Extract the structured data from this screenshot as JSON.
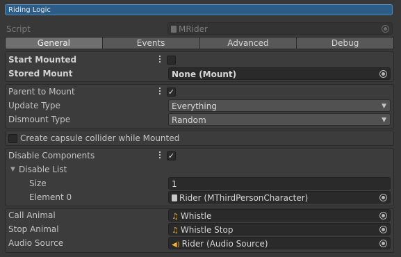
{
  "header": {
    "title": "Riding Logic"
  },
  "script_row": {
    "label": "Script",
    "value": "MRider",
    "icon": "script-file-icon"
  },
  "tabs": [
    {
      "label": "General",
      "active": true
    },
    {
      "label": "Events",
      "active": false
    },
    {
      "label": "Advanced",
      "active": false
    },
    {
      "label": "Debug",
      "active": false
    }
  ],
  "mount": {
    "start_mounted_label": "Start Mounted",
    "start_mounted_checked": false,
    "stored_mount_label": "Stored Mount",
    "stored_mount_value": "None (Mount)"
  },
  "dismount": {
    "parent_to_mount_label": "Parent to Mount",
    "parent_to_mount_checked": true,
    "update_type_label": "Update Type",
    "update_type_value": "Everything",
    "dismount_type_label": "Dismount Type",
    "dismount_type_value": "Random"
  },
  "capsule": {
    "label": "Create capsule collider while Mounted",
    "checked": false
  },
  "components": {
    "disable_label": "Disable Components",
    "disable_checked": true,
    "list_label": "Disable List",
    "size_label": "Size",
    "size_value": "1",
    "element_label": "Element 0",
    "element_value": "Rider (MThirdPersonCharacter)"
  },
  "audio": {
    "call_label": "Call Animal",
    "call_value": "Whistle",
    "stop_label": "Stop Animal",
    "stop_value": "Whistle Stop",
    "source_label": "Audio Source",
    "source_value": "Rider (Audio Source)"
  },
  "colors": {
    "background": "#383838",
    "title_bar": "#2c5d87",
    "field": "#2a2a2a",
    "dropdown": "#515151",
    "audio_icon": "#f0b130"
  }
}
